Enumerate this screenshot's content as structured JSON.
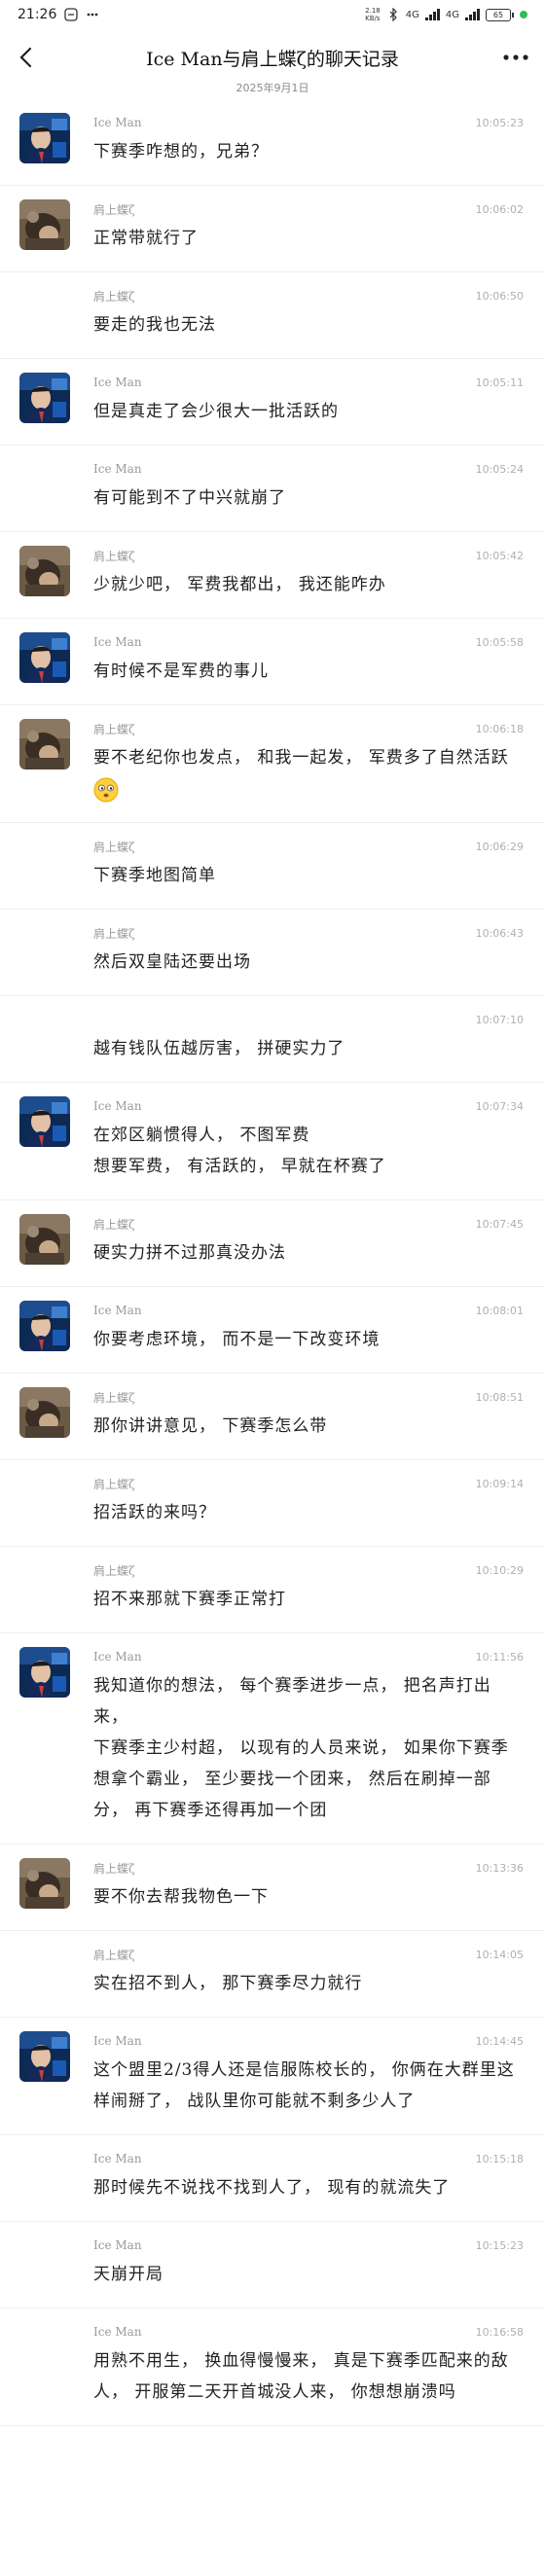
{
  "status_bar": {
    "time": "21:26",
    "network_speed": "2.18\nKB/s",
    "net1": "4G",
    "net2": "4G",
    "battery": "65"
  },
  "header": {
    "title": "Ice Man与肩上蝶ζ的聊天记录",
    "date": "2025年9月1日"
  },
  "colors": {
    "accent_green": "#2ebd59",
    "divider": "#efefef"
  },
  "messages": [
    {
      "sender": "Ice Man",
      "time": "10:05:23",
      "text": "下赛季咋想的，兄弟？",
      "avatar": "iceman"
    },
    {
      "sender": "肩上蝶ζ",
      "time": "10:06:02",
      "text": "正常带就行了",
      "avatar": "butterfly"
    },
    {
      "sender": "肩上蝶ζ",
      "time": "10:06:50",
      "text": "要走的我也无法",
      "avatar": ""
    },
    {
      "sender": "Ice Man",
      "time": "10:05:11",
      "text": "但是真走了会少很大一批活跃的",
      "avatar": "iceman"
    },
    {
      "sender": "Ice Man",
      "time": "10:05:24",
      "text": "有可能到不了中兴就崩了",
      "avatar": ""
    },
    {
      "sender": "肩上蝶ζ",
      "time": "10:05:42",
      "text": "少就少吧， 军费我都出， 我还能咋办",
      "avatar": "butterfly"
    },
    {
      "sender": "Ice Man",
      "time": "10:05:58",
      "text": "有时候不是军费的事儿",
      "avatar": "iceman"
    },
    {
      "sender": "肩上蝶ζ",
      "time": "10:06:18",
      "text": "要不老纪你也发点， 和我一起发， 军费多了自然活跃",
      "avatar": "butterfly",
      "emoji": true
    },
    {
      "sender": "肩上蝶ζ",
      "time": "10:06:29",
      "text": "下赛季地图简单",
      "avatar": ""
    },
    {
      "sender": "肩上蝶ζ",
      "time": "10:06:43",
      "text": "然后双皇陆还要出场",
      "avatar": ""
    },
    {
      "sender": "",
      "time": "10:07:10",
      "text": "越有钱队伍越厉害， 拼硬实力了",
      "avatar": ""
    },
    {
      "sender": "Ice Man",
      "time": "10:07:34",
      "text": "在郊区躺惯得人， 不图军费\n想要军费， 有活跃的， 早就在杯赛了",
      "avatar": "iceman"
    },
    {
      "sender": "肩上蝶ζ",
      "time": "10:07:45",
      "text": "硬实力拼不过那真没办法",
      "avatar": "butterfly"
    },
    {
      "sender": "Ice Man",
      "time": "10:08:01",
      "text": "你要考虑环境， 而不是一下改变环境",
      "avatar": "iceman"
    },
    {
      "sender": "肩上蝶ζ",
      "time": "10:08:51",
      "text": "那你讲讲意见， 下赛季怎么带",
      "avatar": "butterfly"
    },
    {
      "sender": "肩上蝶ζ",
      "time": "10:09:14",
      "text": "招活跃的来吗？",
      "avatar": ""
    },
    {
      "sender": "肩上蝶ζ",
      "time": "10:10:29",
      "text": "招不来那就下赛季正常打",
      "avatar": ""
    },
    {
      "sender": "Ice Man",
      "time": "10:11:56",
      "text": "我知道你的想法， 每个赛季进步一点， 把名声打出来，\n下赛季主少村超， 以现有的人员来说， 如果你下赛季想拿个霸业， 至少要找一个团来， 然后在刷掉一部分， 再下赛季还得再加一个团",
      "avatar": "iceman"
    },
    {
      "sender": "肩上蝶ζ",
      "time": "10:13:36",
      "text": "要不你去帮我物色一下",
      "avatar": "butterfly"
    },
    {
      "sender": "肩上蝶ζ",
      "time": "10:14:05",
      "text": "实在招不到人， 那下赛季尽力就行",
      "avatar": ""
    },
    {
      "sender": "Ice Man",
      "time": "10:14:45",
      "text": "这个盟里2/3得人还是信服陈校长的， 你俩在大群里这样闹掰了， 战队里你可能就不剩多少人了",
      "avatar": "iceman"
    },
    {
      "sender": "Ice Man",
      "time": "10:15:18",
      "text": "那时候先不说找不找到人了， 现有的就流失了",
      "avatar": ""
    },
    {
      "sender": "Ice Man",
      "time": "10:15:23",
      "text": "天崩开局",
      "avatar": ""
    },
    {
      "sender": "Ice Man",
      "time": "10:16:58",
      "text": "用熟不用生， 换血得慢慢来， 真是下赛季匹配来的敌人， 开服第二天开首城没人来， 你想想崩溃吗",
      "avatar": ""
    }
  ]
}
